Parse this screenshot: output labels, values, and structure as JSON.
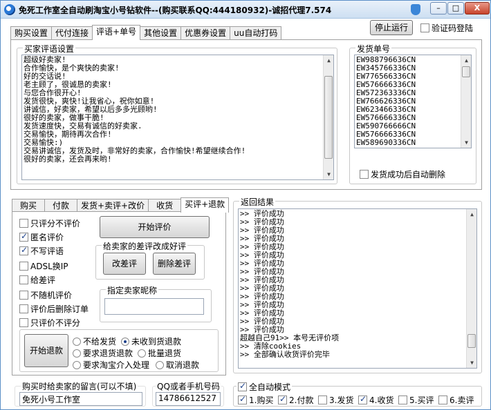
{
  "window": {
    "title": "免死工作室全自动刷淘宝小号钻软件--(购买联系QQ:444180932)-诚招代理7.574",
    "close_glyph": "X",
    "min_glyph": "–",
    "max_glyph": "□"
  },
  "main_tabs": [
    "购买设置",
    "代付连接",
    "评语+单号",
    "其他设置",
    "优惠券设置",
    "uu自动打码"
  ],
  "top_controls": {
    "stop_button": "停止运行",
    "verify_login_label": "验证码登陆",
    "verify_login_checked": false
  },
  "comments": {
    "label": "买家评语设置",
    "lines": [
      "超级好卖家!",
      "合作愉快，是个爽快的卖家!",
      "好的交话说!",
      "老主顾了，很诚恳的卖家!",
      "与您合作很开心!",
      "发货很快，爽快!让我省心，祝你如意!",
      "讲诚信，好卖家，希望以后多多光顾哟!",
      "很好的卖家，做事干脆!",
      "发货速度快，交易有诚信的好卖家.",
      "交易愉快，期待再次合作!",
      "交易愉快:)",
      "交易讲诚信，发货及时，非常好的卖家，合作愉快!希望继续合作!",
      "很好的卖家，还会再来哟!"
    ]
  },
  "shipping": {
    "label": "发货单号",
    "numbers": [
      "EW988796636CN",
      "EW345766336CN",
      "EW776566336CN",
      "EW576666336CN",
      "EW572363336CN",
      "EW766626336CN",
      "EW623466336CN",
      "EW576666336CN",
      "EW590766666CN",
      "EW576666336CN",
      "EW589690336CN"
    ],
    "auto_delete_label": "发货成功后自动删除",
    "auto_delete_checked": false
  },
  "sub_tabs": [
    "购买",
    "付款",
    "发货+卖评+改价",
    "收货",
    "买评+退款"
  ],
  "review_options": [
    {
      "label": "只评分不评价",
      "checked": false
    },
    {
      "label": "匿名评价",
      "checked": true
    },
    {
      "label": "不写评语",
      "checked": true
    },
    {
      "label": "ADSL换IP",
      "checked": false
    },
    {
      "label": "给差评",
      "checked": false
    },
    {
      "label": "不随机评价",
      "checked": false
    },
    {
      "label": "评价后删除订单",
      "checked": false
    },
    {
      "label": "只评价不评分",
      "checked": false
    }
  ],
  "start_review_button": "开始评价",
  "bad_review_group": {
    "label": "给卖家的差评改成好评",
    "modify_button": "改差评",
    "delete_button": "删除差评"
  },
  "seller_nick": {
    "label": "指定卖家昵称",
    "value": ""
  },
  "refund": {
    "start_button": "开始退款",
    "options": [
      {
        "label": "不给发货",
        "checked": false
      },
      {
        "label": "未收到货退款",
        "checked": true
      },
      {
        "label": "要求退货退款",
        "checked": false
      },
      {
        "label": "批量退货",
        "checked": false
      },
      {
        "label": "要求淘宝介入处理",
        "checked": false
      },
      {
        "label": "取消退款",
        "checked": false
      }
    ]
  },
  "results": {
    "label": "返回结果",
    "lines": [
      ">> 评价成功",
      ">> 评价成功",
      ">> 评价成功",
      ">> 评价成功",
      ">> 评价成功",
      ">> 评价成功",
      ">> 评价成功",
      ">> 评价成功",
      ">> 评价成功",
      ">> 评价成功",
      ">> 评价成功",
      ">> 评价成功",
      ">> 评价成功",
      ">> 评价成功",
      ">> 评价成功",
      "超越自己91>> 本号无评价项",
      ">> 清除cookies",
      ">> 全部确认收货评价完毕"
    ]
  },
  "seller_message": {
    "label": "购买时给卖家的留言(可以不填)",
    "value": "免死小号工作室"
  },
  "contact": {
    "label": "QQ或者手机号码",
    "value": "14786612527"
  },
  "auto_mode": {
    "label": "全自动模式",
    "checked": true,
    "steps": [
      {
        "label": "1.购买",
        "checked": true
      },
      {
        "label": "2.付款",
        "checked": true
      },
      {
        "label": "3.发货",
        "checked": false
      },
      {
        "label": "4.收货",
        "checked": true
      },
      {
        "label": "5.买评",
        "checked": false
      },
      {
        "label": "6.卖评",
        "checked": false
      }
    ]
  }
}
